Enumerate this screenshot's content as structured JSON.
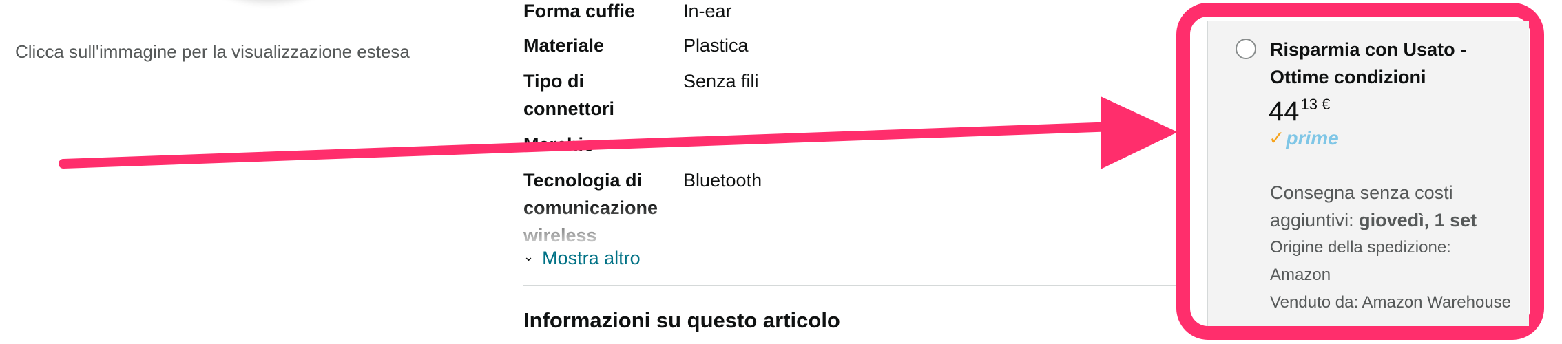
{
  "image_area": {
    "caption": "Clicca sull'immagine per la visualizzazione estesa"
  },
  "specs": {
    "rows": [
      {
        "label": "Forma cuffie",
        "value": "In-ear"
      },
      {
        "label": "Materiale",
        "value": "Plastica"
      },
      {
        "label": "Tipo di connettori",
        "value": "Senza fili"
      },
      {
        "label": "Marchio",
        "value": ""
      },
      {
        "label": "Tecnologia di comunicazione wireless",
        "value": "Bluetooth"
      }
    ],
    "show_more": "Mostra altro"
  },
  "about": {
    "title": "Informazioni su questo articolo"
  },
  "offer": {
    "title": "Risparmia con Usato - Ottime condizioni",
    "price_whole": "44",
    "price_fraction": "13 €",
    "prime_label": "prime",
    "delivery_prefix": "Consegna senza costi aggiuntivi: ",
    "delivery_date": "giovedì, 1 set",
    "origin_label": "Origine della spedizione:",
    "origin_value": "Amazon",
    "seller": "Venduto da: Amazon Warehouse"
  },
  "colors": {
    "annotation": "#ff2e6c",
    "link": "#007185",
    "prime": "#7fc6e6",
    "prime_check": "#f6a31c"
  }
}
